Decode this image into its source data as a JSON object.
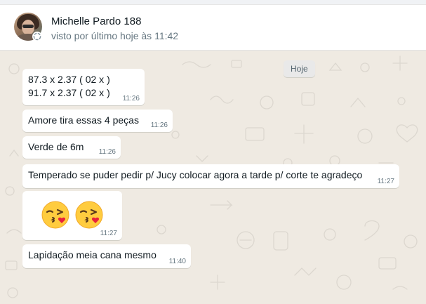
{
  "contact": {
    "name": "Michelle Pardo 188",
    "last_seen": "visto por último hoje às 11:42"
  },
  "chat": {
    "date_label": "Hoje",
    "messages": [
      {
        "lines": [
          "87.3 x 2.37 ( 02 x )",
          "91.7 x 2.37 ( 02 x )"
        ],
        "time": "11:26"
      },
      {
        "text": "Amore tira essas 4 peças",
        "time": "11:26"
      },
      {
        "text": "Verde de 6m",
        "time": "11:26"
      },
      {
        "text": "Temperado se puder pedir p/ Jucy colocar agora a tarde p/ corte te agradeço",
        "time": "11:27"
      },
      {
        "emoji": [
          "kissing-face-emoji",
          "kissing-face-emoji"
        ],
        "time": "11:27"
      },
      {
        "text": "Lapidação meia cana mesmo",
        "time": "11:40"
      }
    ]
  },
  "colors": {
    "chat_background": "#efeae2",
    "bubble": "#ffffff",
    "timestamp": "#667781",
    "status_ring": "#8696a0"
  }
}
